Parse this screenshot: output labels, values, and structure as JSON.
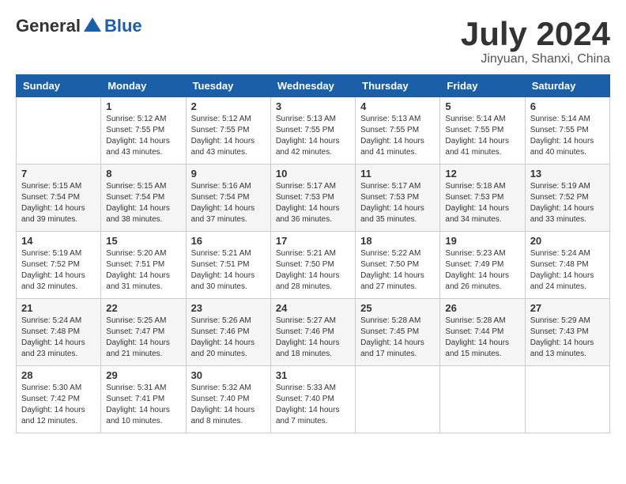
{
  "logo": {
    "general": "General",
    "blue": "Blue"
  },
  "title": "July 2024",
  "location": "Jinyuan, Shanxi, China",
  "days_of_week": [
    "Sunday",
    "Monday",
    "Tuesday",
    "Wednesday",
    "Thursday",
    "Friday",
    "Saturday"
  ],
  "weeks": [
    [
      {
        "day": "",
        "info": ""
      },
      {
        "day": "1",
        "info": "Sunrise: 5:12 AM\nSunset: 7:55 PM\nDaylight: 14 hours\nand 43 minutes."
      },
      {
        "day": "2",
        "info": "Sunrise: 5:12 AM\nSunset: 7:55 PM\nDaylight: 14 hours\nand 43 minutes."
      },
      {
        "day": "3",
        "info": "Sunrise: 5:13 AM\nSunset: 7:55 PM\nDaylight: 14 hours\nand 42 minutes."
      },
      {
        "day": "4",
        "info": "Sunrise: 5:13 AM\nSunset: 7:55 PM\nDaylight: 14 hours\nand 41 minutes."
      },
      {
        "day": "5",
        "info": "Sunrise: 5:14 AM\nSunset: 7:55 PM\nDaylight: 14 hours\nand 41 minutes."
      },
      {
        "day": "6",
        "info": "Sunrise: 5:14 AM\nSunset: 7:55 PM\nDaylight: 14 hours\nand 40 minutes."
      }
    ],
    [
      {
        "day": "7",
        "info": "Sunrise: 5:15 AM\nSunset: 7:54 PM\nDaylight: 14 hours\nand 39 minutes."
      },
      {
        "day": "8",
        "info": "Sunrise: 5:15 AM\nSunset: 7:54 PM\nDaylight: 14 hours\nand 38 minutes."
      },
      {
        "day": "9",
        "info": "Sunrise: 5:16 AM\nSunset: 7:54 PM\nDaylight: 14 hours\nand 37 minutes."
      },
      {
        "day": "10",
        "info": "Sunrise: 5:17 AM\nSunset: 7:53 PM\nDaylight: 14 hours\nand 36 minutes."
      },
      {
        "day": "11",
        "info": "Sunrise: 5:17 AM\nSunset: 7:53 PM\nDaylight: 14 hours\nand 35 minutes."
      },
      {
        "day": "12",
        "info": "Sunrise: 5:18 AM\nSunset: 7:53 PM\nDaylight: 14 hours\nand 34 minutes."
      },
      {
        "day": "13",
        "info": "Sunrise: 5:19 AM\nSunset: 7:52 PM\nDaylight: 14 hours\nand 33 minutes."
      }
    ],
    [
      {
        "day": "14",
        "info": "Sunrise: 5:19 AM\nSunset: 7:52 PM\nDaylight: 14 hours\nand 32 minutes."
      },
      {
        "day": "15",
        "info": "Sunrise: 5:20 AM\nSunset: 7:51 PM\nDaylight: 14 hours\nand 31 minutes."
      },
      {
        "day": "16",
        "info": "Sunrise: 5:21 AM\nSunset: 7:51 PM\nDaylight: 14 hours\nand 30 minutes."
      },
      {
        "day": "17",
        "info": "Sunrise: 5:21 AM\nSunset: 7:50 PM\nDaylight: 14 hours\nand 28 minutes."
      },
      {
        "day": "18",
        "info": "Sunrise: 5:22 AM\nSunset: 7:50 PM\nDaylight: 14 hours\nand 27 minutes."
      },
      {
        "day": "19",
        "info": "Sunrise: 5:23 AM\nSunset: 7:49 PM\nDaylight: 14 hours\nand 26 minutes."
      },
      {
        "day": "20",
        "info": "Sunrise: 5:24 AM\nSunset: 7:48 PM\nDaylight: 14 hours\nand 24 minutes."
      }
    ],
    [
      {
        "day": "21",
        "info": "Sunrise: 5:24 AM\nSunset: 7:48 PM\nDaylight: 14 hours\nand 23 minutes."
      },
      {
        "day": "22",
        "info": "Sunrise: 5:25 AM\nSunset: 7:47 PM\nDaylight: 14 hours\nand 21 minutes."
      },
      {
        "day": "23",
        "info": "Sunrise: 5:26 AM\nSunset: 7:46 PM\nDaylight: 14 hours\nand 20 minutes."
      },
      {
        "day": "24",
        "info": "Sunrise: 5:27 AM\nSunset: 7:46 PM\nDaylight: 14 hours\nand 18 minutes."
      },
      {
        "day": "25",
        "info": "Sunrise: 5:28 AM\nSunset: 7:45 PM\nDaylight: 14 hours\nand 17 minutes."
      },
      {
        "day": "26",
        "info": "Sunrise: 5:28 AM\nSunset: 7:44 PM\nDaylight: 14 hours\nand 15 minutes."
      },
      {
        "day": "27",
        "info": "Sunrise: 5:29 AM\nSunset: 7:43 PM\nDaylight: 14 hours\nand 13 minutes."
      }
    ],
    [
      {
        "day": "28",
        "info": "Sunrise: 5:30 AM\nSunset: 7:42 PM\nDaylight: 14 hours\nand 12 minutes."
      },
      {
        "day": "29",
        "info": "Sunrise: 5:31 AM\nSunset: 7:41 PM\nDaylight: 14 hours\nand 10 minutes."
      },
      {
        "day": "30",
        "info": "Sunrise: 5:32 AM\nSunset: 7:40 PM\nDaylight: 14 hours\nand 8 minutes."
      },
      {
        "day": "31",
        "info": "Sunrise: 5:33 AM\nSunset: 7:40 PM\nDaylight: 14 hours\nand 7 minutes."
      },
      {
        "day": "",
        "info": ""
      },
      {
        "day": "",
        "info": ""
      },
      {
        "day": "",
        "info": ""
      }
    ]
  ]
}
